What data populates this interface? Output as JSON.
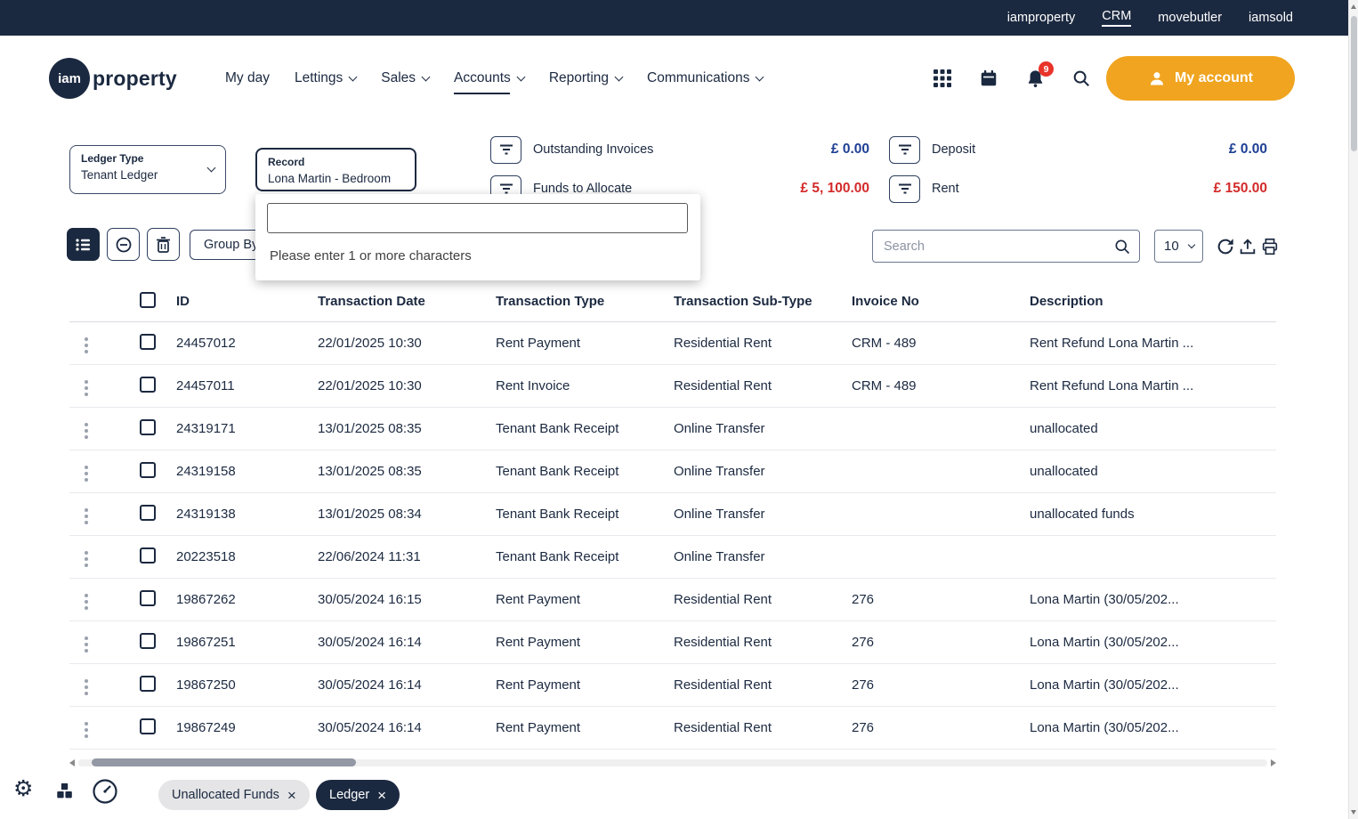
{
  "colors": {
    "navy": "#1b2940",
    "accent_orange": "#f0a41f",
    "amount_negative_red": "#d32a2a",
    "amount_blue": "#1d3f94",
    "badge_red": "#e8332a"
  },
  "icons": {
    "gear": "⚙",
    "close": "×"
  },
  "top_bar": {
    "links": [
      {
        "label": "iamproperty",
        "active": false
      },
      {
        "label": "CRM",
        "active": true
      },
      {
        "label": "movebutler",
        "active": false
      },
      {
        "label": "iamsold",
        "active": false
      }
    ]
  },
  "header": {
    "logo_iam": "iam",
    "logo_property": "property",
    "nav": [
      {
        "label": "My day",
        "dropdown": false,
        "active": false
      },
      {
        "label": "Lettings",
        "dropdown": true,
        "active": false
      },
      {
        "label": "Sales",
        "dropdown": true,
        "active": false
      },
      {
        "label": "Accounts",
        "dropdown": true,
        "active": true
      },
      {
        "label": "Reporting",
        "dropdown": true,
        "active": false
      },
      {
        "label": "Communications",
        "dropdown": true,
        "active": false
      }
    ],
    "notification_badge": "9",
    "my_account": "My account"
  },
  "filters": {
    "ledger_type_label": "Ledger Type",
    "ledger_type_value": "Tenant Ledger",
    "record_label": "Record",
    "record_value": "Lona Martin - Bedroom",
    "stats": [
      {
        "label": "Outstanding Invoices",
        "value": "£ 0.00",
        "value_color": "#1d3f94"
      },
      {
        "label": "Funds to Allocate",
        "value": "£ 5, 100.00",
        "value_color": "#d32a2a"
      },
      {
        "label": "Deposit",
        "value": "£ 0.00",
        "value_color": "#1d3f94"
      },
      {
        "label": "Rent",
        "value": "£ 150.00",
        "value_color": "#d32a2a"
      }
    ]
  },
  "record_dropdown": {
    "search_value": "",
    "hint": "Please enter 1 or more characters"
  },
  "toolbar": {
    "group_by": "Group By",
    "search_placeholder": "Search",
    "page_size": "10"
  },
  "table": {
    "columns": [
      "ID",
      "Transaction Date",
      "Transaction Type",
      "Transaction Sub-Type",
      "Invoice No",
      "Description"
    ],
    "rows": [
      {
        "id": "24457012",
        "date": "22/01/2025 10:30",
        "type": "Rent Payment",
        "sub_type": "Residential Rent",
        "invoice_no": "CRM - 489",
        "description": "Rent Refund Lona Martin ..."
      },
      {
        "id": "24457011",
        "date": "22/01/2025 10:30",
        "type": "Rent Invoice",
        "sub_type": "Residential Rent",
        "invoice_no": "CRM - 489",
        "description": "Rent Refund Lona Martin ..."
      },
      {
        "id": "24319171",
        "date": "13/01/2025 08:35",
        "type": "Tenant Bank Receipt",
        "sub_type": "Online Transfer",
        "invoice_no": "",
        "description": "unallocated"
      },
      {
        "id": "24319158",
        "date": "13/01/2025 08:35",
        "type": "Tenant Bank Receipt",
        "sub_type": "Online Transfer",
        "invoice_no": "",
        "description": "unallocated"
      },
      {
        "id": "24319138",
        "date": "13/01/2025 08:34",
        "type": "Tenant Bank Receipt",
        "sub_type": "Online Transfer",
        "invoice_no": "",
        "description": "unallocated funds"
      },
      {
        "id": "20223518",
        "date": "22/06/2024 11:31",
        "type": "Tenant Bank Receipt",
        "sub_type": "Online Transfer",
        "invoice_no": "",
        "description": ""
      },
      {
        "id": "19867262",
        "date": "30/05/2024 16:15",
        "type": "Rent Payment",
        "sub_type": "Residential Rent",
        "invoice_no": "276",
        "description": "Lona Martin (30/05/202..."
      },
      {
        "id": "19867251",
        "date": "30/05/2024 16:14",
        "type": "Rent Payment",
        "sub_type": "Residential Rent",
        "invoice_no": "276",
        "description": "Lona Martin (30/05/202..."
      },
      {
        "id": "19867250",
        "date": "30/05/2024 16:14",
        "type": "Rent Payment",
        "sub_type": "Residential Rent",
        "invoice_no": "276",
        "description": "Lona Martin (30/05/202..."
      },
      {
        "id": "19867249",
        "date": "30/05/2024 16:14",
        "type": "Rent Payment",
        "sub_type": "Residential Rent",
        "invoice_no": "276",
        "description": "Lona Martin (30/05/202..."
      }
    ]
  },
  "footer": {
    "tabs": [
      {
        "label": "Unallocated Funds",
        "active": false
      },
      {
        "label": "Ledger",
        "active": true
      }
    ]
  }
}
